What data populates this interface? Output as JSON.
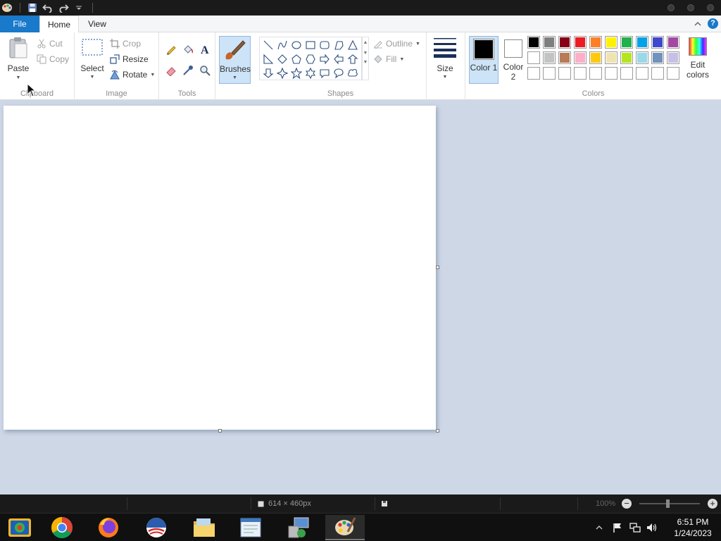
{
  "titlebar": {
    "quick_access": [
      "paint-app-icon",
      "save-icon",
      "undo-icon",
      "redo-icon",
      "customize-dropdown-icon"
    ]
  },
  "tabs": {
    "file": "File",
    "home": "Home",
    "view": "View"
  },
  "clipboard": {
    "label": "Clipboard",
    "paste": "Paste",
    "cut": "Cut",
    "copy": "Copy"
  },
  "image": {
    "label": "Image",
    "select": "Select",
    "crop": "Crop",
    "resize": "Resize",
    "rotate": "Rotate"
  },
  "tools": {
    "label": "Tools",
    "items": [
      "pencil-icon",
      "fill-bucket-icon",
      "text-icon",
      "eraser-icon",
      "color-picker-icon",
      "magnifier-icon"
    ]
  },
  "brushes": {
    "label": "Brushes"
  },
  "shapes": {
    "label": "Shapes",
    "outline": "Outline",
    "fill": "Fill"
  },
  "size": {
    "label": "Size"
  },
  "colors": {
    "label": "Colors",
    "color1_label": "Color 1",
    "color2_label": "Color 2",
    "edit_colors": "Edit colors",
    "color1": "#000000",
    "color2": "#ffffff",
    "row1": [
      "#000000",
      "#7f7f7f",
      "#880015",
      "#ed1c24",
      "#ff7f27",
      "#fff200",
      "#22b14c",
      "#00a2e8",
      "#3f48cc",
      "#a349a4"
    ],
    "row2": [
      "#ffffff",
      "#c3c3c3",
      "#b97a57",
      "#ffaec9",
      "#ffc90e",
      "#efe4b0",
      "#b5e61d",
      "#99d9ea",
      "#7092be",
      "#c8bfe7"
    ],
    "row3": [
      "#ffffff",
      "#ffffff",
      "#ffffff",
      "#ffffff",
      "#ffffff",
      "#ffffff",
      "#ffffff",
      "#ffffff",
      "#ffffff",
      "#ffffff"
    ]
  },
  "statusbar": {
    "dimensions": "614 × 460px",
    "zoom": "100%"
  },
  "taskbar": {
    "apps": [
      "photos-icon",
      "chrome-icon",
      "firefox-icon",
      "obama-logo-icon",
      "file-explorer-icon",
      "notepad-icon",
      "network-setup-icon",
      "paint-icon"
    ],
    "time": "6:51 PM",
    "date": "1/24/2023"
  }
}
